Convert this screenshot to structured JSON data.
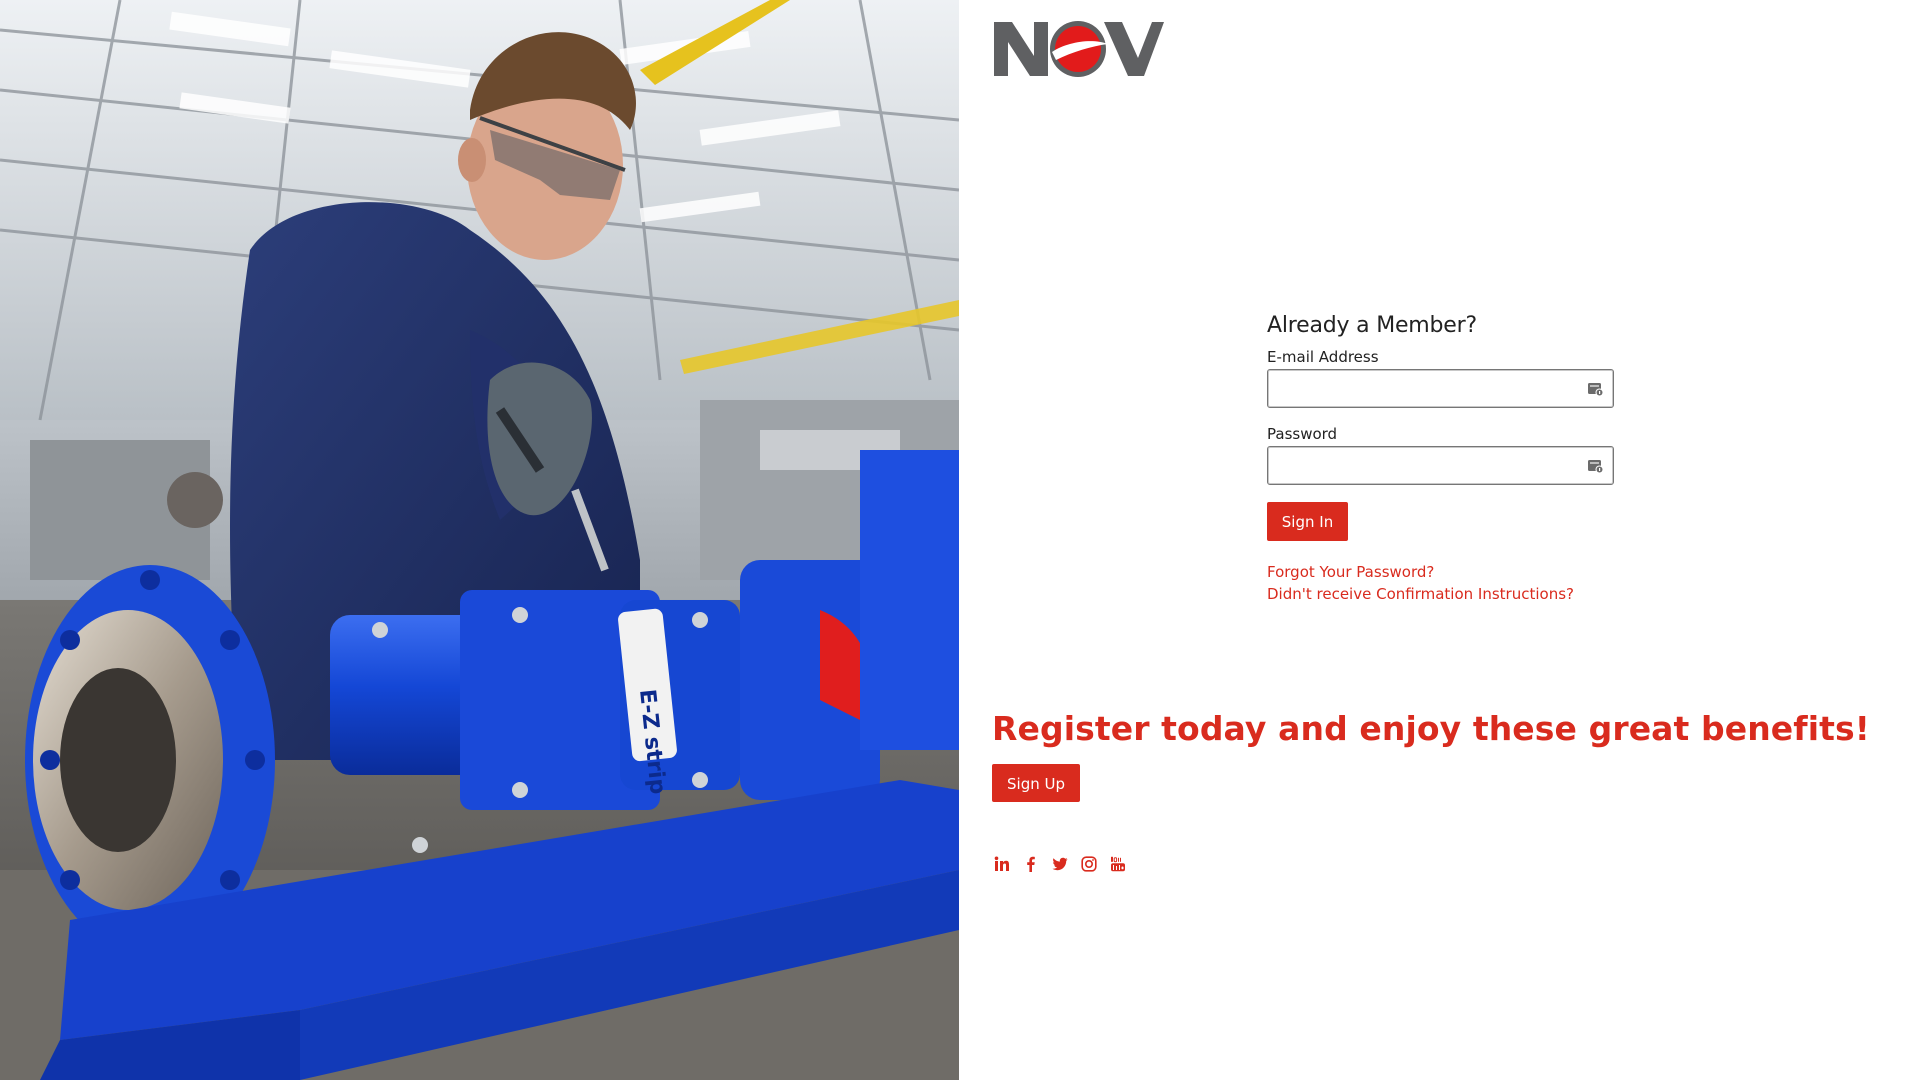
{
  "brand": {
    "logo_text": "NOV",
    "accent_color": "#d92b1e",
    "logo_gray": "#5f6062"
  },
  "hero": {
    "label_text": "E-Z strip"
  },
  "login": {
    "heading": "Already a Member?",
    "email_label": "E-mail Address",
    "email_value": "",
    "password_label": "Password",
    "password_value": "",
    "field_icon": "password-manager-icon",
    "sign_in_label": "Sign In",
    "forgot_password_link": "Forgot Your Password?",
    "confirmation_link": "Didn't receive Confirmation Instructions?"
  },
  "register": {
    "headline": "Register today and enjoy these great benefits!",
    "sign_up_label": "Sign Up"
  },
  "social": {
    "icons": [
      "linkedin-icon",
      "facebook-icon",
      "twitter-icon",
      "instagram-icon",
      "youtube-icon"
    ]
  }
}
